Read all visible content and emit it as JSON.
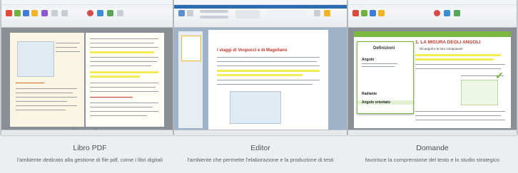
{
  "panels": [
    {
      "name": "libro-pdf",
      "title": "Libro PDF",
      "subtitle": "l'ambiente dedicato alla gestione di file pdf, come i libri digitali"
    },
    {
      "name": "editor",
      "title": "Editor",
      "subtitle": "l'ambiente che permette l'elaborazione e la produzione di testi",
      "doc_heading": "I viaggi di Vespucci e di Magellano"
    },
    {
      "name": "domande",
      "title": "Domande",
      "subtitle": "favorisce la comprensione del testo e lo studio strategico",
      "chapter_title": "1. LA MISURA DEGLI ANGOLI",
      "chapter_subtitle": "Gli angoli e le loro componenti",
      "popup_title": "Definizioni",
      "popup_item1": "Angolo",
      "popup_item2": "Radiante",
      "popup_item3": "Angolo orientato"
    }
  ],
  "colors": {
    "accent_green": "#7ab640",
    "highlight_yellow": "#f3ec55",
    "heading_red": "#c0392b",
    "ribbon_blue": "#2b6cb0"
  }
}
